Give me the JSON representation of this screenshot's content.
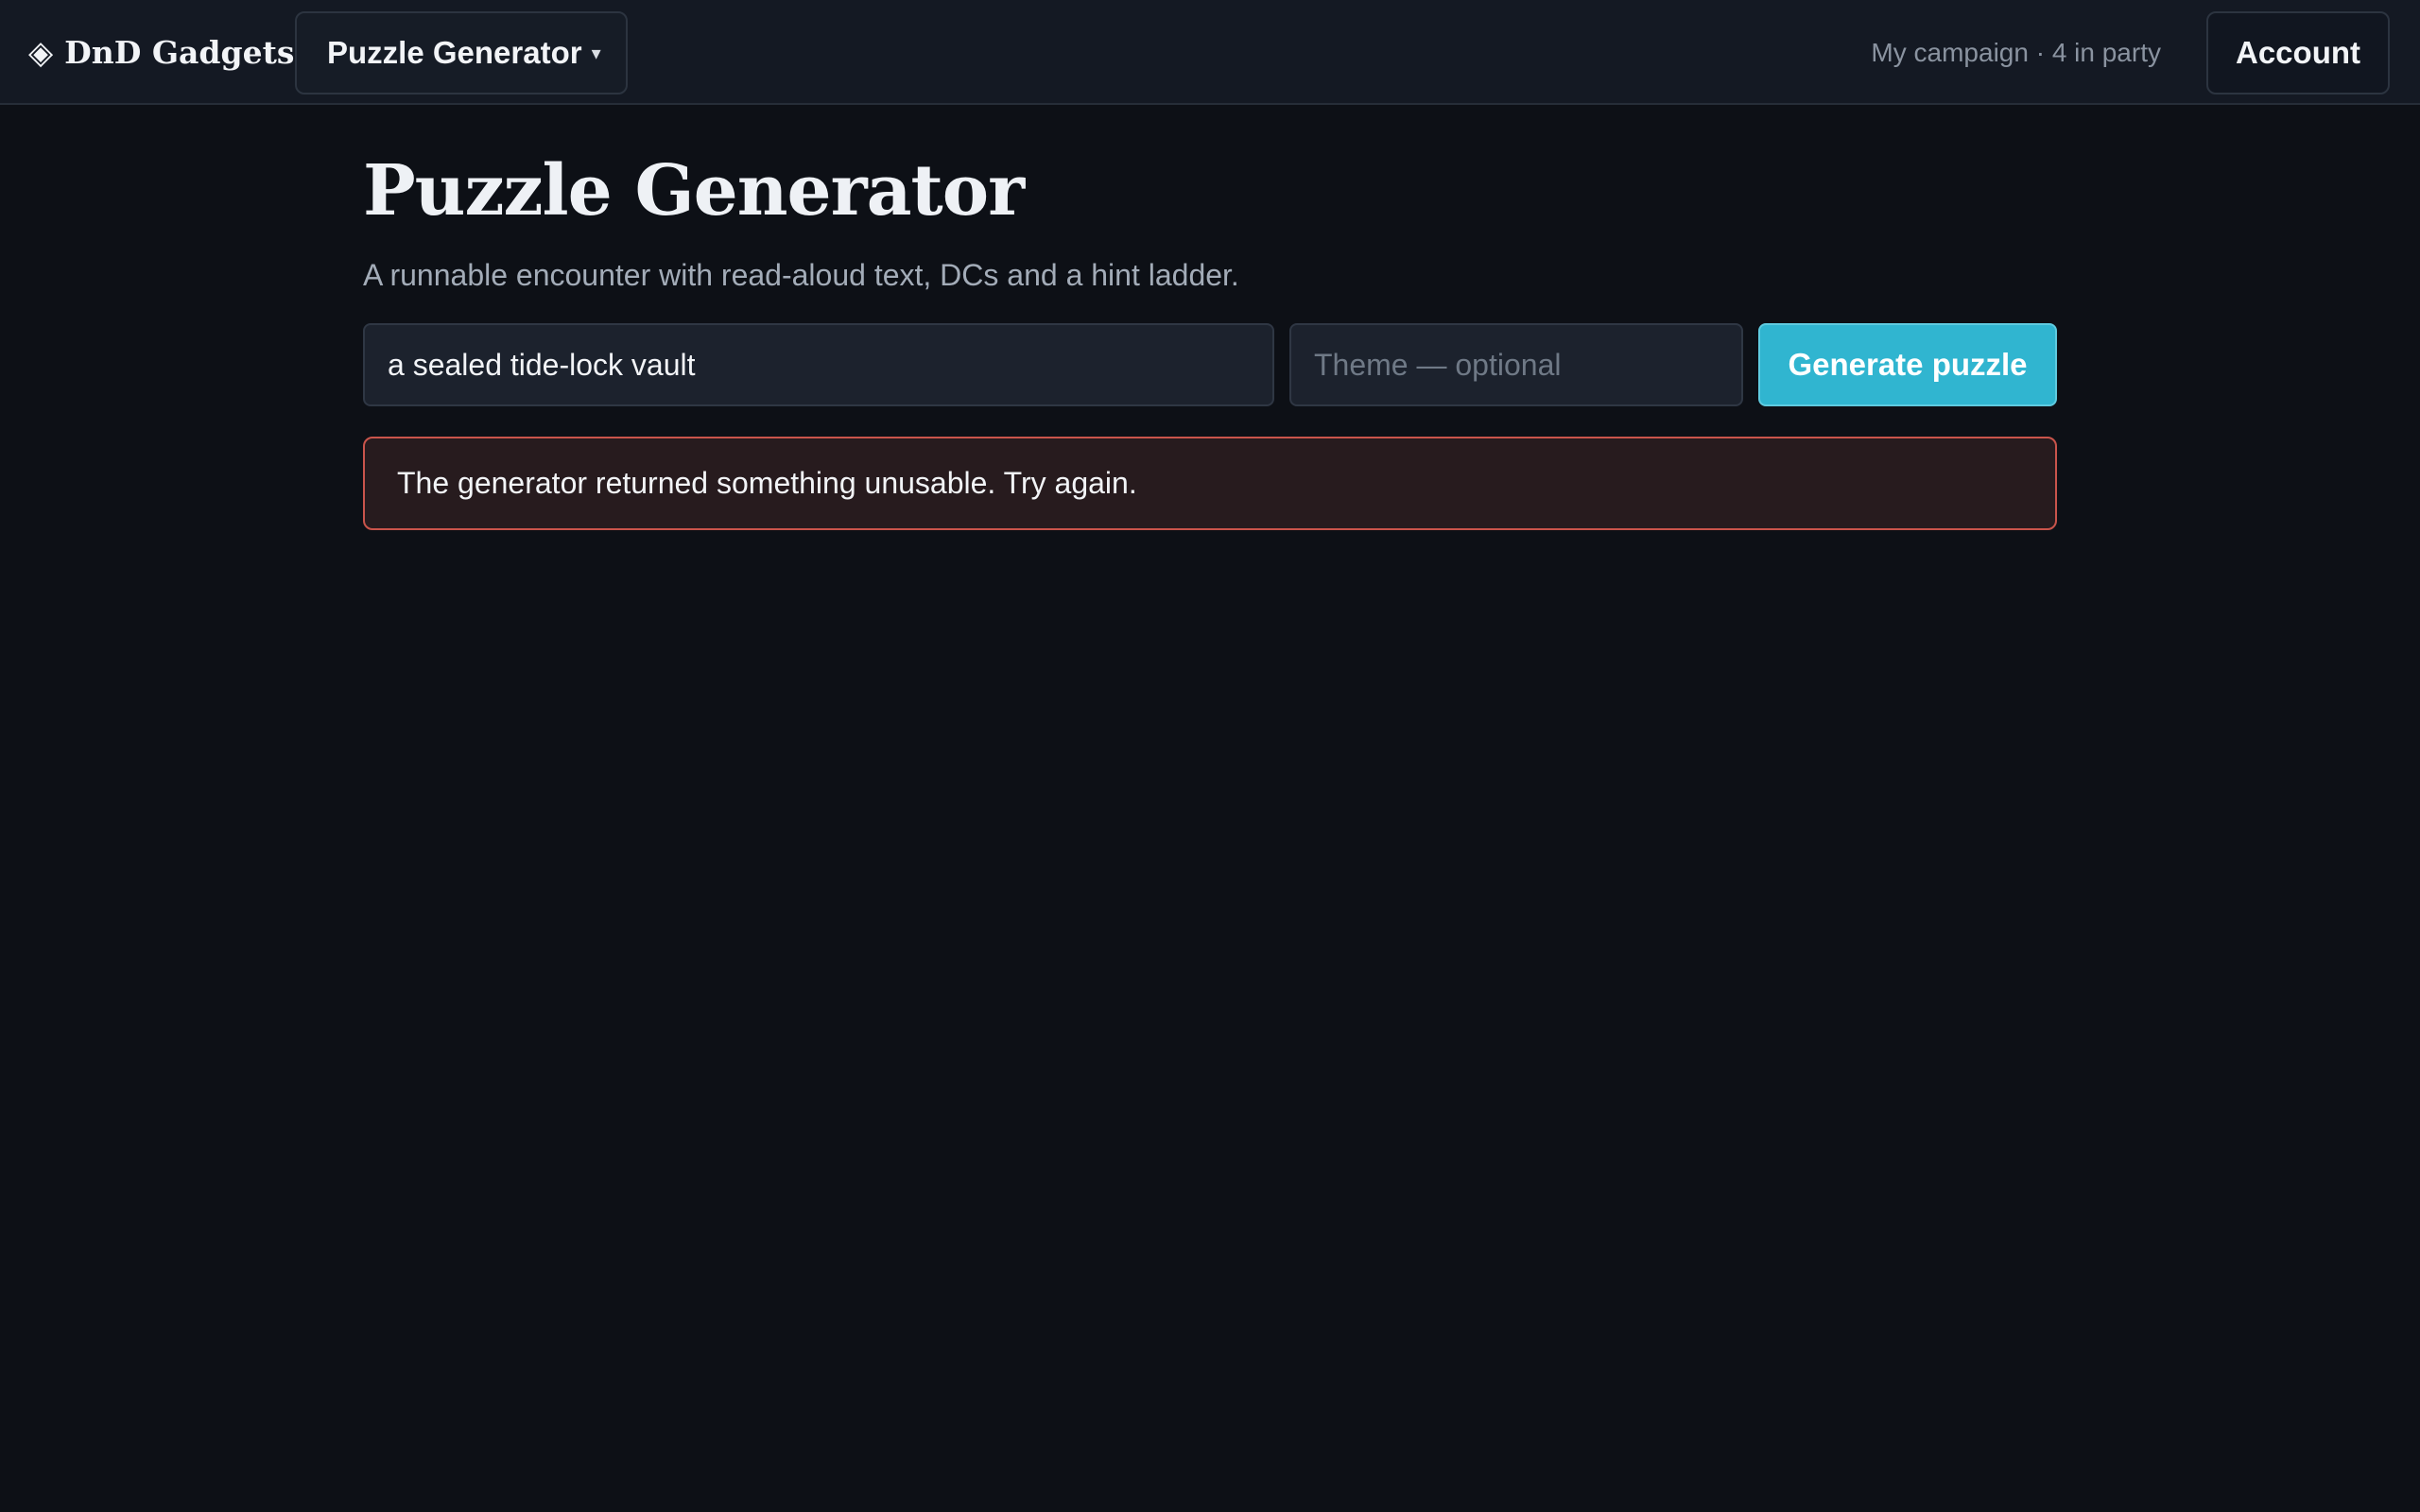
{
  "app": {
    "brand_name": "DnD Gadgets",
    "brand_icon": "◈"
  },
  "header": {
    "tool_selector_label": "Puzzle Generator",
    "tool_selector_caret": "▾",
    "campaign_status": "My campaign · 4 in party",
    "account_label": "Account"
  },
  "page": {
    "title": "Puzzle Generator",
    "subtitle": "A runnable encounter with read-aloud text, DCs and a hint ladder."
  },
  "form": {
    "prompt_value": "a sealed tide-lock vault",
    "theme_value": "",
    "theme_placeholder": "Theme — optional",
    "generate_label": "Generate puzzle"
  },
  "error": {
    "message": "The generator returned something unusable. Try again."
  },
  "colors": {
    "accent": "#30b5d0",
    "error_border": "#c9544b",
    "background": "#0d1016"
  }
}
